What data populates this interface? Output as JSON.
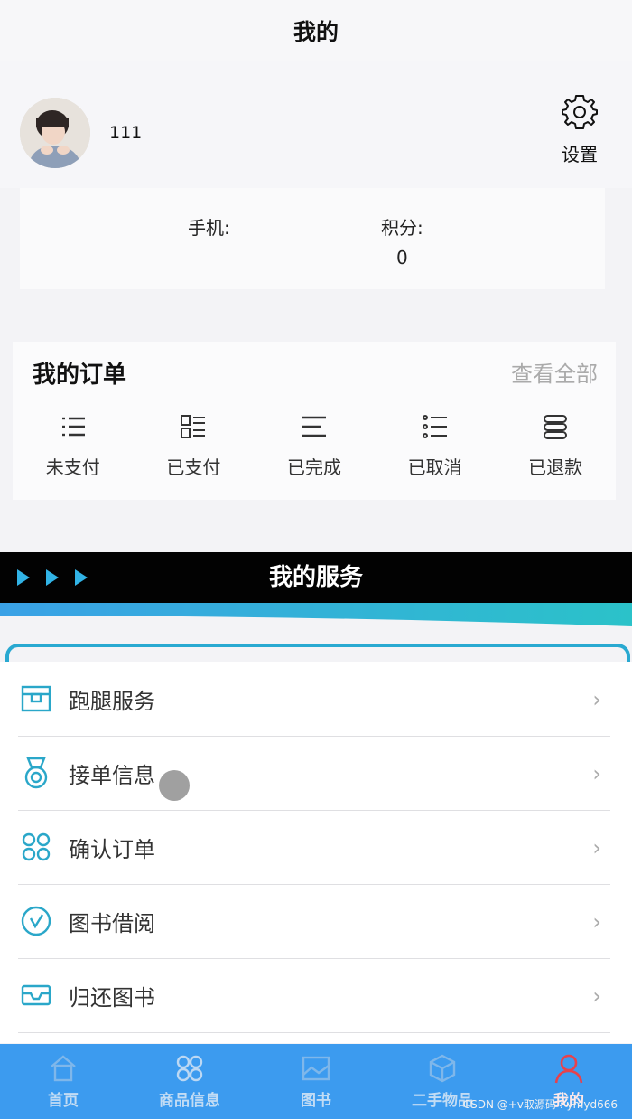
{
  "header": {
    "title": "我的"
  },
  "profile": {
    "username": "111",
    "settings_label": "设置",
    "phone_label": "手机:",
    "points_label": "积分:",
    "points_value": "0"
  },
  "orders": {
    "title": "我的订单",
    "view_all": "查看全部",
    "items": [
      {
        "label": "未支付",
        "icon": "list-icon"
      },
      {
        "label": "已支付",
        "icon": "grid-list-icon"
      },
      {
        "label": "已完成",
        "icon": "lines-icon"
      },
      {
        "label": "已取消",
        "icon": "checklist-icon"
      },
      {
        "label": "已退款",
        "icon": "stack-icon"
      }
    ]
  },
  "services": {
    "title": "我的服务",
    "items": [
      {
        "label": "跑腿服务",
        "icon": "box-icon"
      },
      {
        "label": "接单信息",
        "icon": "medal-icon"
      },
      {
        "label": "确认订单",
        "icon": "cluster-icon"
      },
      {
        "label": "图书借阅",
        "icon": "clock-icon"
      },
      {
        "label": "归还图书",
        "icon": "vr-glasses-icon"
      }
    ]
  },
  "tabbar": {
    "items": [
      {
        "label": "首页",
        "icon": "home-icon",
        "active": false
      },
      {
        "label": "商品信息",
        "icon": "grid-icon",
        "active": false
      },
      {
        "label": "图书",
        "icon": "picture-icon",
        "active": false
      },
      {
        "label": "二手物品",
        "icon": "cube-icon",
        "active": false
      },
      {
        "label": "我的",
        "icon": "user-icon",
        "active": true
      }
    ]
  },
  "watermark": "CSDN @+v取源码 : ymyd666",
  "colors": {
    "accent": "#29a9d1",
    "tabbar": "#3c9bef",
    "active_tab": "#e8414b"
  }
}
